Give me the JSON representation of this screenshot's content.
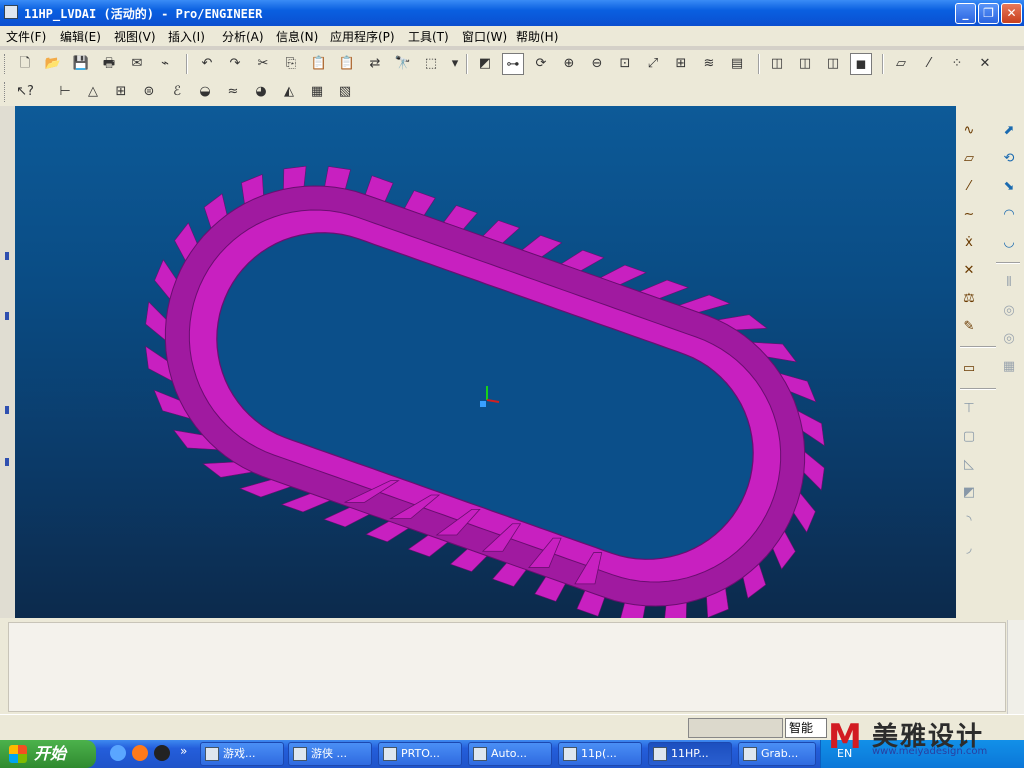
{
  "window": {
    "title": "11HP_LVDAI (活动的) - Pro/ENGINEER",
    "min": "_",
    "max": "❐",
    "close": "✕"
  },
  "menu": [
    "文件(F)",
    "编辑(E)",
    "视图(V)",
    "插入(I)",
    "分析(A)",
    "信息(N)",
    "应用程序(P)",
    "工具(T)",
    "窗口(W)",
    "帮助(H)"
  ],
  "toolbar1": [
    {
      "name": "new-icon",
      "glyph": "🗋"
    },
    {
      "name": "open-icon",
      "glyph": "📂"
    },
    {
      "name": "save-icon",
      "glyph": "💾"
    },
    {
      "name": "print-icon",
      "glyph": "🖶"
    },
    {
      "name": "email-icon",
      "glyph": "✉"
    },
    {
      "name": "email-link-icon",
      "glyph": "⌁"
    },
    {
      "name": "undo-icon",
      "glyph": "↶"
    },
    {
      "name": "redo-icon",
      "glyph": "↷"
    },
    {
      "name": "cut-icon",
      "glyph": "✂"
    },
    {
      "name": "copy-icon",
      "glyph": "⎘"
    },
    {
      "name": "paste-icon",
      "glyph": "📋"
    },
    {
      "name": "paste-special-icon",
      "glyph": "📋"
    },
    {
      "name": "regenerate-icon",
      "glyph": "⇄"
    },
    {
      "name": "find-icon",
      "glyph": "🔭"
    },
    {
      "name": "select-box-icon",
      "glyph": "⬚"
    },
    {
      "name": "select-dropdown-icon",
      "glyph": "▾"
    },
    {
      "name": "redraw-icon",
      "glyph": "◩"
    },
    {
      "name": "spin-center-icon",
      "glyph": "⊶"
    },
    {
      "name": "orient-icon",
      "glyph": "⟳"
    },
    {
      "name": "zoom-in-icon",
      "glyph": "⊕"
    },
    {
      "name": "zoom-out-icon",
      "glyph": "⊖"
    },
    {
      "name": "refit-icon",
      "glyph": "⊡"
    },
    {
      "name": "reorient-icon",
      "glyph": "⤢"
    },
    {
      "name": "saved-views-icon",
      "glyph": "⊞"
    },
    {
      "name": "layers-icon",
      "glyph": "≋"
    },
    {
      "name": "view-manager-icon",
      "glyph": "▤"
    },
    {
      "name": "wireframe-icon",
      "glyph": "◫"
    },
    {
      "name": "hidden-line-icon",
      "glyph": "◫"
    },
    {
      "name": "no-hidden-icon",
      "glyph": "◫"
    },
    {
      "name": "shading-icon",
      "glyph": "◼"
    },
    {
      "name": "datum-planes-icon",
      "glyph": "⏥"
    },
    {
      "name": "datum-axes-icon",
      "glyph": "⁄"
    },
    {
      "name": "datum-points-icon",
      "glyph": "⁘"
    },
    {
      "name": "coord-sys-icon",
      "glyph": "✕"
    }
  ],
  "toolbar2": [
    {
      "name": "context-help-icon",
      "glyph": "↖?"
    },
    {
      "name": "measure-icon",
      "glyph": "⊢"
    },
    {
      "name": "section-icon",
      "glyph": "△"
    },
    {
      "name": "table-icon",
      "glyph": "⊞"
    },
    {
      "name": "mass-props-icon",
      "glyph": "⊜"
    },
    {
      "name": "curve-analysis-icon",
      "glyph": "ℰ"
    },
    {
      "name": "surface-analysis-icon",
      "glyph": "◒"
    },
    {
      "name": "curvature-icon",
      "glyph": "≈"
    },
    {
      "name": "draft-icon",
      "glyph": "◕"
    },
    {
      "name": "slope-icon",
      "glyph": "◭"
    },
    {
      "name": "saved-analysis-icon",
      "glyph": "▦"
    },
    {
      "name": "hide-analysis-icon",
      "glyph": "▧"
    }
  ],
  "right_toolbar": {
    "col1": [
      {
        "name": "sketched-curve-icon",
        "glyph": "∿"
      },
      {
        "name": "datum-plane-icon",
        "glyph": "▱"
      },
      {
        "name": "datum-axis-icon",
        "glyph": "⁄"
      },
      {
        "name": "datum-curve-icon",
        "glyph": "∼"
      },
      {
        "name": "datum-point-icon",
        "glyph": "ẋ"
      },
      {
        "name": "datum-csys-icon",
        "glyph": "✕"
      },
      {
        "name": "analysis-feature-icon",
        "glyph": "⚖"
      },
      {
        "name": "offset-point-icon",
        "glyph": "✎"
      },
      {
        "name": "note-icon",
        "glyph": "▭"
      },
      {
        "name": "hole-icon",
        "glyph": "⊤"
      },
      {
        "name": "shell-icon",
        "glyph": "▢"
      },
      {
        "name": "rib-icon",
        "glyph": "◺"
      },
      {
        "name": "draft-feature-icon",
        "glyph": "◩"
      },
      {
        "name": "round-icon",
        "glyph": "◝"
      },
      {
        "name": "chamfer-icon",
        "glyph": "◞"
      }
    ],
    "col2": [
      {
        "name": "extrude-icon",
        "glyph": "⬈"
      },
      {
        "name": "revolve-icon",
        "glyph": "⟲"
      },
      {
        "name": "sweep-icon",
        "glyph": "⬊"
      },
      {
        "name": "boundary-blend-icon",
        "glyph": "◠"
      },
      {
        "name": "style-icon",
        "glyph": "◡"
      },
      {
        "name": "mirror-icon",
        "glyph": "⫴"
      },
      {
        "name": "merge-icon",
        "glyph": "◎"
      },
      {
        "name": "trim-icon",
        "glyph": "◎"
      },
      {
        "name": "pattern-icon",
        "glyph": "▦"
      }
    ]
  },
  "status": {
    "smart_filter": "智能"
  },
  "taskbar": {
    "start": "开始",
    "overflow": "»",
    "tasks": [
      {
        "label": "游戏..."
      },
      {
        "label": "游侠 ..."
      },
      {
        "label": "PRTO..."
      },
      {
        "label": "Auto..."
      },
      {
        "label": "11p(..."
      },
      {
        "label": "11HP..."
      },
      {
        "label": "Grab..."
      }
    ],
    "tray_lang": "EN"
  },
  "watermark": {
    "logo": "M",
    "text": "美雅设计",
    "url": "www.meiyadesign.com"
  },
  "colors": {
    "model_fill": "#a01aa0",
    "model_light": "#c820c0",
    "model_dark": "#6a0e70",
    "viewport_top": "#0d5a98",
    "viewport_bottom": "#0c2a4c"
  },
  "track": {
    "outer_teeth": 40,
    "inner_lugs": 18,
    "visible_lugs": 6
  }
}
